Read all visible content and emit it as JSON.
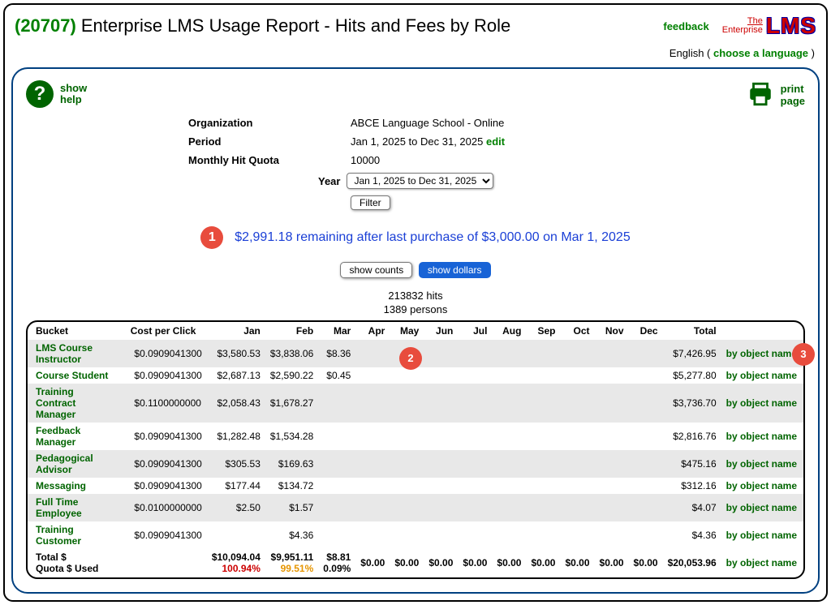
{
  "header": {
    "page_id": "(20707)",
    "title": "Enterprise LMS Usage Report - Hits and Fees by Role",
    "feedback": "feedback",
    "logo_prefix1": "The",
    "logo_prefix2": "Enterprise",
    "logo_text": "LMS"
  },
  "lang": {
    "current": "English",
    "paren1": " ( ",
    "choose": "choose a language",
    "paren2": " )"
  },
  "help": {
    "line1": "show",
    "line2": "help"
  },
  "print": {
    "line1": "print",
    "line2": "page"
  },
  "info": {
    "org_label": "Organization",
    "org_value": "ABCE Language School - Online",
    "period_label": "Period",
    "period_value": "Jan 1, 2025 to Dec 31, 2025",
    "period_edit": "edit",
    "quota_label": "Monthly Hit Quota",
    "quota_value": "10000",
    "year_label": "Year",
    "year_select": "Jan 1, 2025 to Dec 31, 2025",
    "filter": "Filter"
  },
  "remaining": "$2,991.18 remaining after last purchase of $3,000.00 on Mar 1, 2025",
  "toggle": {
    "counts": "show counts",
    "dollars": "show dollars"
  },
  "summary": {
    "hits": "213832 hits",
    "persons": "1389 persons"
  },
  "table": {
    "headers": [
      "Bucket",
      "Cost per Click",
      "Jan",
      "Feb",
      "Mar",
      "Apr",
      "May",
      "Jun",
      "Jul",
      "Aug",
      "Sep",
      "Oct",
      "Nov",
      "Dec",
      "Total",
      ""
    ],
    "link_text": "by object name",
    "rows": [
      {
        "bucket": "LMS Course Instructor",
        "cpc": "$0.0909041300",
        "vals": [
          "$3,580.53",
          "$3,838.06",
          "$8.36",
          "",
          "",
          "",
          "",
          "",
          "",
          "",
          "",
          ""
        ],
        "total": "$7,426.95"
      },
      {
        "bucket": "Course Student",
        "cpc": "$0.0909041300",
        "vals": [
          "$2,687.13",
          "$2,590.22",
          "$0.45",
          "",
          "",
          "",
          "",
          "",
          "",
          "",
          "",
          ""
        ],
        "total": "$5,277.80"
      },
      {
        "bucket": "Training Contract Manager",
        "cpc": "$0.1100000000",
        "vals": [
          "$2,058.43",
          "$1,678.27",
          "",
          "",
          "",
          "",
          "",
          "",
          "",
          "",
          "",
          ""
        ],
        "total": "$3,736.70"
      },
      {
        "bucket": "Feedback Manager",
        "cpc": "$0.0909041300",
        "vals": [
          "$1,282.48",
          "$1,534.28",
          "",
          "",
          "",
          "",
          "",
          "",
          "",
          "",
          "",
          ""
        ],
        "total": "$2,816.76"
      },
      {
        "bucket": "Pedagogical Advisor",
        "cpc": "$0.0909041300",
        "vals": [
          "$305.53",
          "$169.63",
          "",
          "",
          "",
          "",
          "",
          "",
          "",
          "",
          "",
          ""
        ],
        "total": "$475.16"
      },
      {
        "bucket": "Messaging",
        "cpc": "$0.0909041300",
        "vals": [
          "$177.44",
          "$134.72",
          "",
          "",
          "",
          "",
          "",
          "",
          "",
          "",
          "",
          ""
        ],
        "total": "$312.16"
      },
      {
        "bucket": "Full Time Employee",
        "cpc": "$0.0100000000",
        "vals": [
          "$2.50",
          "$1.57",
          "",
          "",
          "",
          "",
          "",
          "",
          "",
          "",
          "",
          ""
        ],
        "total": "$4.07"
      },
      {
        "bucket": "Training Customer",
        "cpc": "$0.0909041300",
        "vals": [
          "",
          "$4.36",
          "",
          "",
          "",
          "",
          "",
          "",
          "",
          "",
          "",
          ""
        ],
        "total": "$4.36"
      }
    ],
    "total_row": {
      "label": "Total $\nQuota $ Used",
      "vals": [
        "$10,094.04",
        "$9,951.11",
        "$8.81",
        "$0.00",
        "$0.00",
        "$0.00",
        "$0.00",
        "$0.00",
        "$0.00",
        "$0.00",
        "$0.00",
        "$0.00"
      ],
      "quota": [
        "100.94%",
        "99.51%",
        "0.09%",
        "",
        "",
        "",
        "",
        "",
        "",
        "",
        "",
        ""
      ],
      "quota_class": [
        "quota-red",
        "quota-org",
        "",
        "",
        "",
        "",
        "",
        "",
        "",
        "",
        "",
        ""
      ],
      "total": "$20,053.96"
    }
  },
  "annotations": {
    "a1": "1",
    "a2": "2",
    "a3": "3"
  }
}
